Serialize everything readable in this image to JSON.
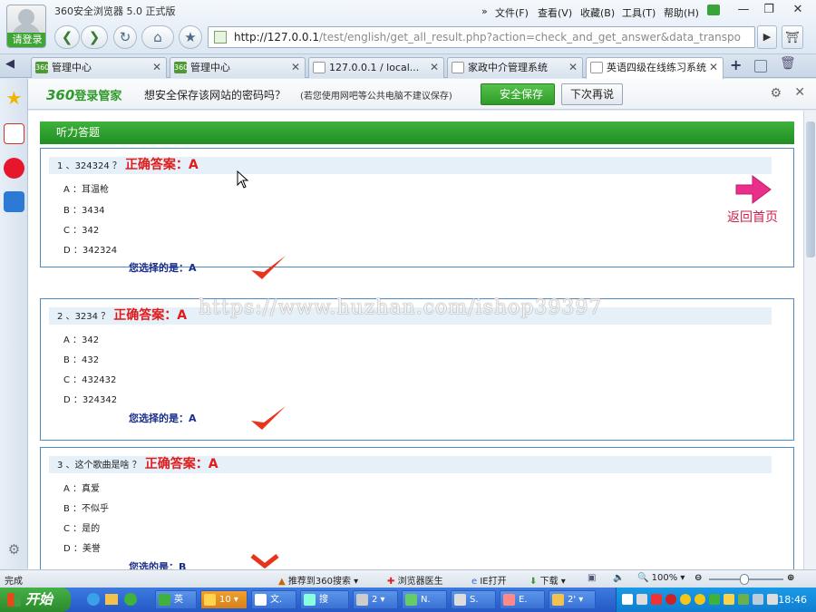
{
  "window": {
    "app_title": "360安全浏览器 5.0 正式版",
    "login_label": "请登录",
    "menu": [
      "文件(F)",
      "查看(V)",
      "收藏(B)",
      "工具(T)",
      "帮助(H)"
    ],
    "controls": {
      "minimize": "—",
      "maximize": "❐",
      "close": "✕"
    }
  },
  "nav": {
    "url_host": "http://127.0.0.1",
    "url_rest": "/test/english/get_all_result.php?action=check_and_get_answer&data_transport=X"
  },
  "tabs": [
    {
      "label": "管理中心",
      "icon": "360",
      "active": false
    },
    {
      "label": "管理中心",
      "icon": "360",
      "active": false
    },
    {
      "label": "127.0.0.1 / local...",
      "icon": "pma",
      "active": false
    },
    {
      "label": "家政中介管理系统",
      "icon": "page",
      "active": false
    },
    {
      "label": "英语四级在线练习系统",
      "icon": "page",
      "active": true
    }
  ],
  "password_bar": {
    "logo_num": "360",
    "logo_text": "登录管家",
    "question": "想安全保存该网站的密码吗？",
    "note": "(若您使用网吧等公共电脑不建议保存)",
    "save_label": "安全保存",
    "later_label": "下次再说"
  },
  "page": {
    "section_title": "听力答题",
    "back_label": "返回首页",
    "questions": [
      {
        "number": "1",
        "text": "324324",
        "answer_label": "正确答案：A",
        "options": [
          "A ：耳温枪",
          "B ：3434",
          "C ：342",
          "D ：342324"
        ],
        "choice_label": "您选择的是：A",
        "result": "correct"
      },
      {
        "number": "2",
        "text": "3234",
        "answer_label": "正确答案：A",
        "options": [
          "A ：342",
          "B ：432",
          "C ：432432",
          "D ：324342"
        ],
        "choice_label": "您选择的是：A",
        "result": "correct"
      },
      {
        "number": "3",
        "text": "这个歌曲是啥",
        "answer_label": "正确答案：A",
        "options": [
          "A ：真爱",
          "B ：不似乎",
          "C ：是的",
          "D ：美誉"
        ],
        "choice_label": "您选的是：B",
        "result": "wrong"
      }
    ]
  },
  "watermark": "https://www.huzhan.com/ishop39397",
  "status": {
    "left": "完成",
    "search": "推荐到360搜索",
    "doctor": "浏览器医生",
    "ie": "IE打开",
    "download": "下载",
    "zoom": "100%"
  },
  "taskbar": {
    "start": "开始",
    "tasks": [
      "英",
      "10",
      "文.",
      "搜",
      "2",
      "N.",
      "S.",
      "E.",
      "2'"
    ],
    "clock": "18:46"
  },
  "colors": {
    "accent_green": "#2f9c29",
    "answer_red": "#e01b1b",
    "choice_blue": "#1a2f8a",
    "box_border": "#4d8bc3"
  }
}
